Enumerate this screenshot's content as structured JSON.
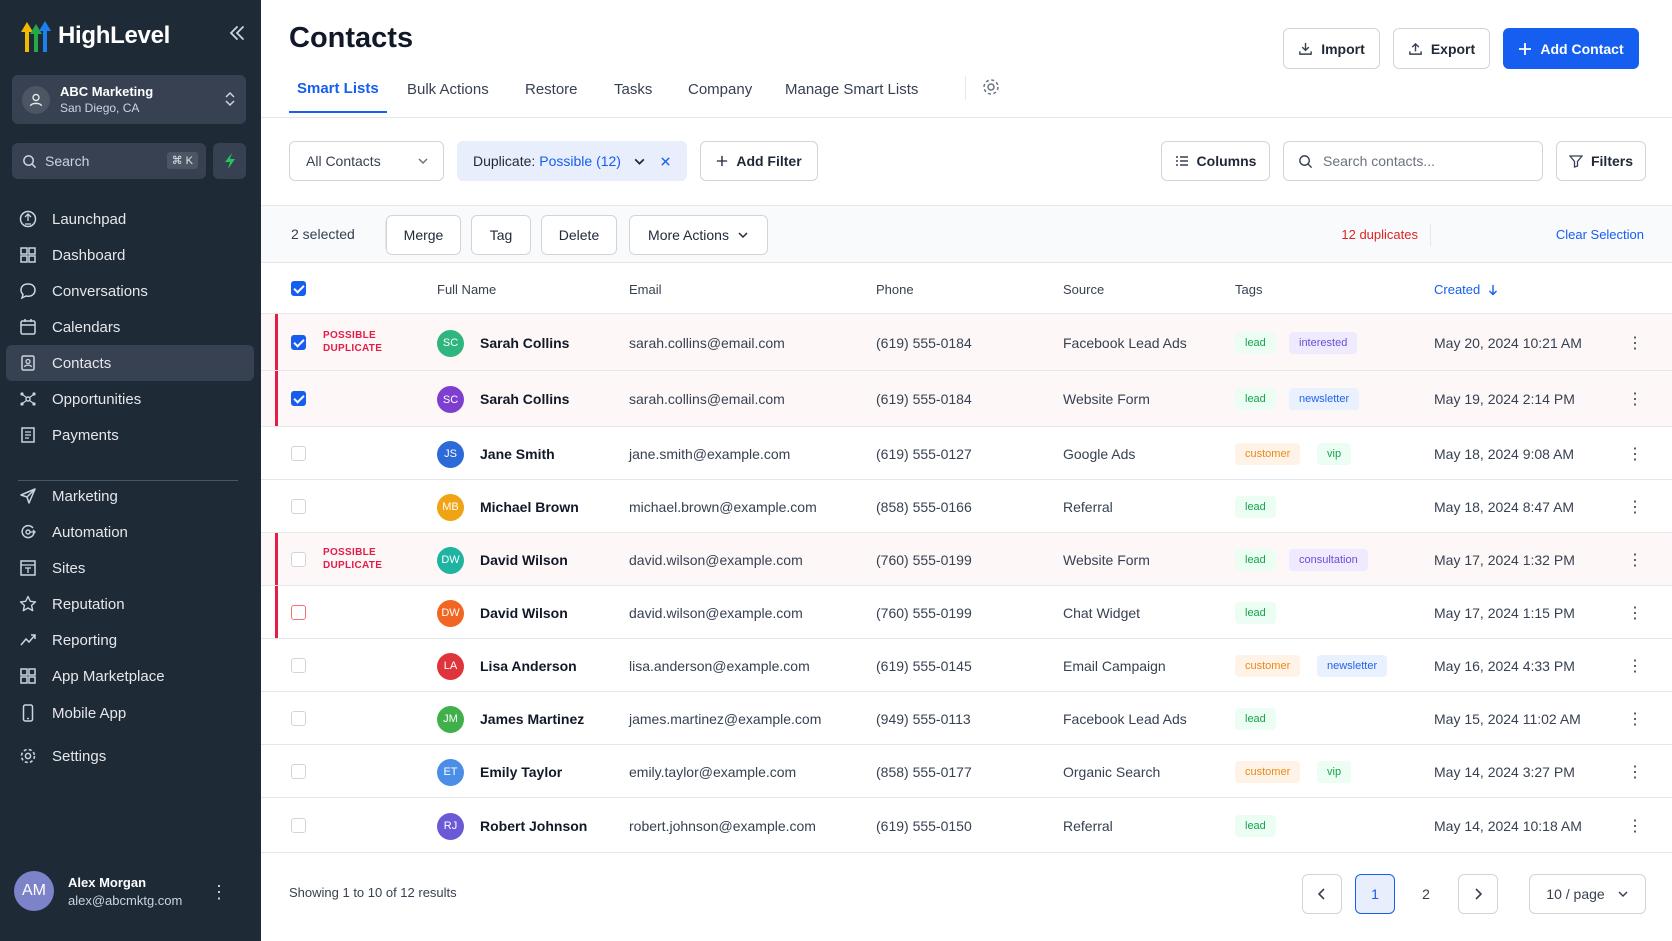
{
  "app": {
    "name": "HighLevel"
  },
  "account": {
    "name": "ABC Marketing",
    "location": "San Diego, CA"
  },
  "search": {
    "label": "Search",
    "shortcut": "⌘ K"
  },
  "nav": [
    {
      "label": "Launchpad",
      "icon": "launchpad-icon"
    },
    {
      "label": "Dashboard",
      "icon": "dashboard-icon"
    },
    {
      "label": "Conversations",
      "icon": "chat-icon"
    },
    {
      "label": "Calendars",
      "icon": "calendar-icon"
    },
    {
      "label": "Contacts",
      "icon": "contacts-icon",
      "active": true
    },
    {
      "label": "Opportunities",
      "icon": "opportunities-icon"
    },
    {
      "label": "Payments",
      "icon": "payments-icon"
    },
    {
      "label": "Marketing",
      "icon": "send-icon"
    },
    {
      "label": "Automation",
      "icon": "automation-icon"
    },
    {
      "label": "Sites",
      "icon": "sites-icon"
    },
    {
      "label": "Reputation",
      "icon": "star-icon"
    },
    {
      "label": "Reporting",
      "icon": "trend-icon"
    },
    {
      "label": "App Marketplace",
      "icon": "apps-icon"
    },
    {
      "label": "Mobile App",
      "icon": "mobile-icon"
    },
    {
      "label": "Settings",
      "icon": "gear-icon"
    }
  ],
  "user": {
    "initials": "AM",
    "name": "Alex Morgan",
    "email": "alex@abcmktg.com"
  },
  "header": {
    "title": "Contacts",
    "import_label": "Import",
    "export_label": "Export",
    "add_label": "Add Contact"
  },
  "tabs": [
    "Smart Lists",
    "Bulk Actions",
    "Restore",
    "Tasks",
    "Company",
    "Manage Smart Lists"
  ],
  "filters": {
    "list": "All Contacts",
    "dup_prefix": "Duplicate:",
    "dup_value": "Possible (12)",
    "add_filter": "Add Filter",
    "columns": "Columns",
    "search_placeholder": "Search contacts...",
    "filters": "Filters"
  },
  "selection": {
    "count": "2 selected",
    "merge": "Merge",
    "tag": "Tag",
    "delete": "Delete",
    "more": "More Actions",
    "duplicates": "12 duplicates",
    "clear": "Clear Selection"
  },
  "columns": {
    "name": "Full Name",
    "email": "Email",
    "phone": "Phone",
    "source": "Source",
    "tags": "Tags",
    "created": "Created"
  },
  "dup_label_line1": "POSSIBLE",
  "dup_label_line2": "DUPLICATE",
  "rows": [
    {
      "initials": "SC",
      "color": "#2fb57e",
      "name": "Sarah Collins",
      "email": "sarah.collins@email.com",
      "phone": "(619) 555-0184",
      "source": "Facebook Lead Ads",
      "tags": [
        "lead",
        "interested"
      ],
      "created": "May 20, 2024 10:21 AM",
      "checked": true,
      "dup_label": true,
      "dup_bg": true
    },
    {
      "initials": "SC",
      "color": "#7e3fd1",
      "name": "Sarah Collins",
      "email": "sarah.collins@email.com",
      "phone": "(619) 555-0184",
      "source": "Website Form",
      "tags": [
        "lead",
        "newsletter"
      ],
      "created": "May 19, 2024 2:14 PM",
      "checked": true,
      "dup_label": false,
      "dup_bg": true
    },
    {
      "initials": "JS",
      "color": "#2b6ad8",
      "name": "Jane Smith",
      "email": "jane.smith@example.com",
      "phone": "(619) 555-0127",
      "source": "Google Ads",
      "tags": [
        "customer",
        "vip"
      ],
      "created": "May 18, 2024 9:08 AM"
    },
    {
      "initials": "MB",
      "color": "#f0a313",
      "name": "Michael Brown",
      "email": "michael.brown@example.com",
      "phone": "(858) 555-0166",
      "source": "Referral",
      "tags": [
        "lead"
      ],
      "created": "May 18, 2024 8:47 AM"
    },
    {
      "initials": "DW",
      "color": "#1fb3a2",
      "name": "David Wilson",
      "email": "david.wilson@example.com",
      "phone": "(760) 555-0199",
      "source": "Website Form",
      "tags": [
        "lead",
        "consultation"
      ],
      "created": "May 17, 2024 1:32 PM",
      "dup_label": true,
      "dup_bg": true
    },
    {
      "initials": "DW",
      "color": "#f26522",
      "name": "David Wilson",
      "email": "david.wilson@example.com",
      "phone": "(760) 555-0199",
      "source": "Chat Widget",
      "tags": [
        "lead"
      ],
      "created": "May 17, 2024 1:15 PM",
      "dup_bg": false,
      "dup_edge": true
    },
    {
      "initials": "LA",
      "color": "#e0343c",
      "name": "Lisa Anderson",
      "email": "lisa.anderson@example.com",
      "phone": "(619) 555-0145",
      "source": "Email Campaign",
      "tags": [
        "customer",
        "newsletter"
      ],
      "created": "May 16, 2024 4:33 PM"
    },
    {
      "initials": "JM",
      "color": "#3fb04a",
      "name": "James Martinez",
      "email": "james.martinez@example.com",
      "phone": "(949) 555-0113",
      "source": "Facebook Lead Ads",
      "tags": [
        "lead"
      ],
      "created": "May 15, 2024 11:02 AM"
    },
    {
      "initials": "ET",
      "color": "#4a8ee8",
      "name": "Emily Taylor",
      "email": "emily.taylor@example.com",
      "phone": "(858) 555-0177",
      "source": "Organic Search",
      "tags": [
        "customer",
        "vip"
      ],
      "created": "May 14, 2024 3:27 PM"
    },
    {
      "initials": "RJ",
      "color": "#6b5ad6",
      "name": "Robert Johnson",
      "email": "robert.johnson@example.com",
      "phone": "(619) 555-0150",
      "source": "Referral",
      "tags": [
        "lead"
      ],
      "created": "May 14, 2024 10:18 AM"
    }
  ],
  "footer": {
    "showing": "Showing 1 to 10 of 12 results",
    "pages": [
      "1",
      "2"
    ],
    "current_page": "1",
    "per_page": "10 / page"
  }
}
